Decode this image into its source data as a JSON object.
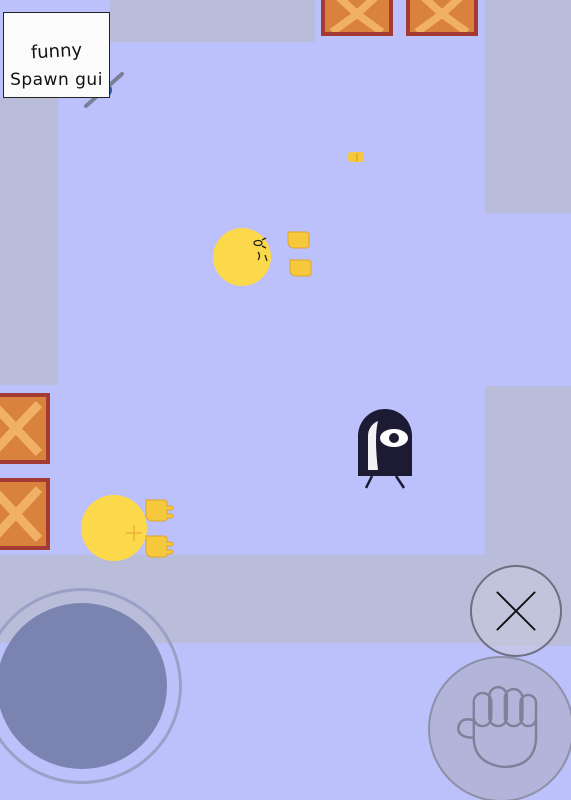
{
  "spawn_gui": {
    "line1": "funny",
    "line2": "Spawn gui"
  },
  "colors": {
    "floor": "#bcc0fb",
    "wall": "#b9bdd9",
    "crate_fill": "#d9823d",
    "crate_border": "#a33a33",
    "crate_mark": "#f0b167",
    "player_body": "#fcd94a",
    "player_hand": "#f6c83c",
    "enemy_body": "#1d1a33",
    "joystick": "#7b84b0"
  },
  "icons": {
    "close_button": "x-icon",
    "grab_button": "fist-icon",
    "tool": "pen-icon"
  }
}
